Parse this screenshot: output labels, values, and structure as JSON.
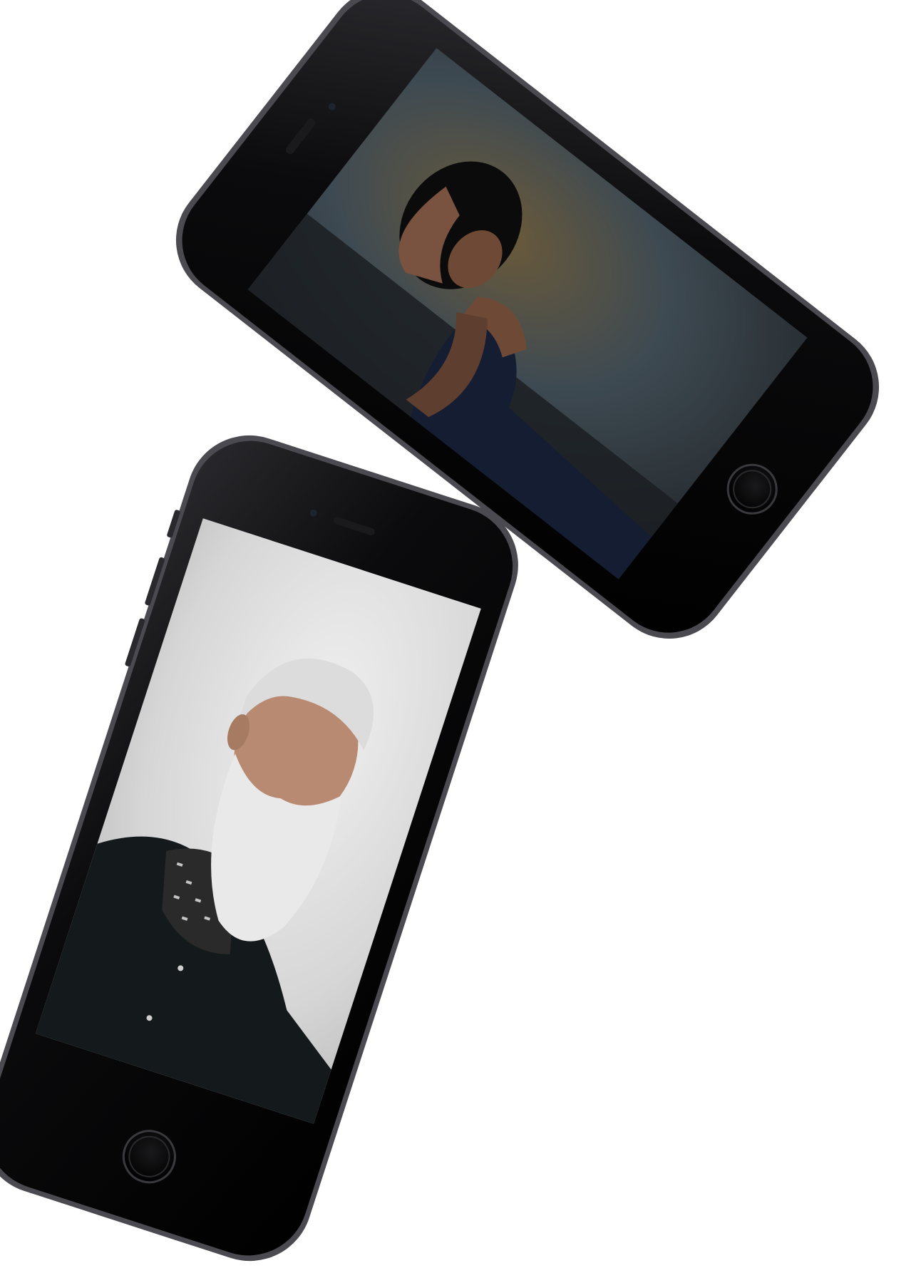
{
  "scene": {
    "background": "#ffffff",
    "devices": [
      {
        "id": "phone-top",
        "color": "#0a0a0c",
        "screen_subject": "woman-portrait",
        "screen_palette": {
          "bg_dark": "#1f2326",
          "bg_mid": "#3e4a52",
          "bg_warm": "#6b5a3a",
          "dress": "#151d33",
          "skin": "#6e4a36"
        }
      },
      {
        "id": "phone-bottom",
        "color": "#0a0a0c",
        "screen_subject": "man-portrait",
        "screen_palette": {
          "bg_light": "#e6e6e6",
          "bg_mid": "#c9c9c9",
          "coat": "#141a1c",
          "beard": "#e9e9e9",
          "skin": "#b88a72"
        }
      }
    ]
  }
}
